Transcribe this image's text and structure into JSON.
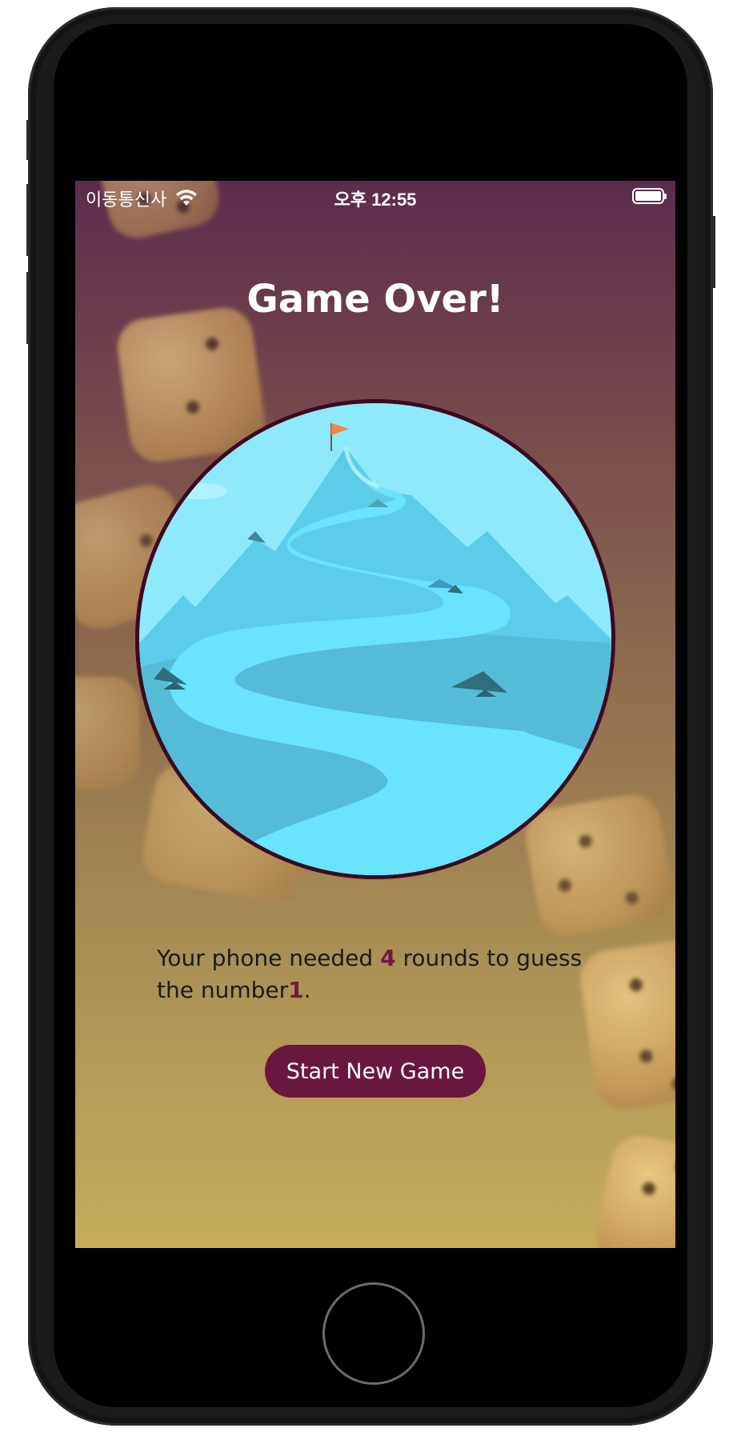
{
  "status_bar": {
    "carrier": "이동통신사",
    "time": "오후 12:55",
    "wifi_icon": "wifi-icon",
    "battery_icon": "battery-icon"
  },
  "screen": {
    "title": "Game Over!",
    "image": "mountain-summit-illustration",
    "summary": {
      "prefix": "Your phone needed ",
      "rounds": "4",
      "middle": " rounds to guess the number",
      "number": "1",
      "suffix": "."
    },
    "button_label": "Start New Game"
  },
  "colors": {
    "accent": "#6a1740",
    "highlight": "#6f1a44",
    "gradient_top": "#5c2c4c",
    "gradient_bottom": "#c6ad5c",
    "title_text": "#ffffff"
  }
}
